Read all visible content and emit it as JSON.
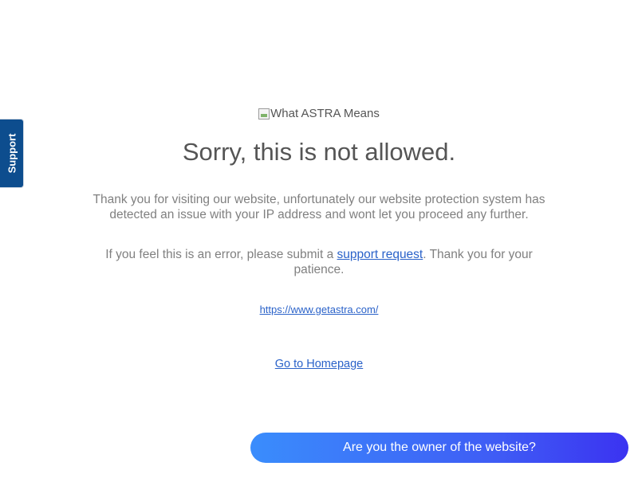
{
  "support_tab": {
    "label": "Support"
  },
  "logo": {
    "alt_text": "What ASTRA Means"
  },
  "heading": "Sorry, this is not allowed.",
  "message_1": "Thank you for visiting our website, unfortunately our website protection system has detected an issue with your IP address and wont let you proceed any further.",
  "message_2": {
    "before": "If you feel this is an error, please submit a ",
    "link": "support request",
    "after": ". Thank you for your patience."
  },
  "site_link": "https://www.getastra.com/",
  "homepage_link": "Go to Homepage",
  "owner_button": "Are you the owner of the website?",
  "colors": {
    "support_tab": "#0d4d8e",
    "link": "#2a62c9",
    "button_start": "#3a8dfc",
    "button_end": "#3b33f1"
  }
}
